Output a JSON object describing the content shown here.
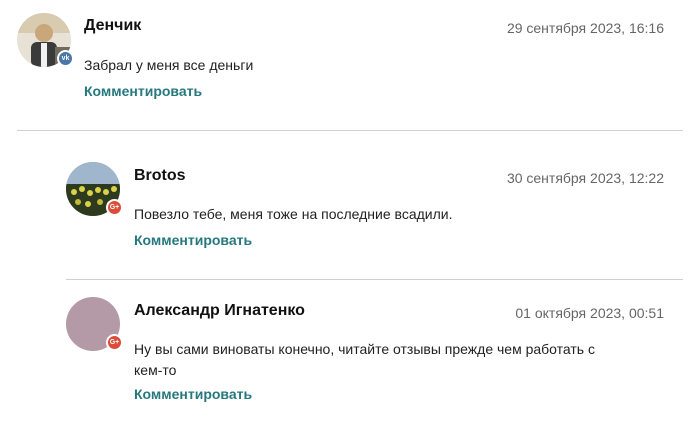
{
  "comments": [
    {
      "author": "Денчик",
      "date": "29 сентября 2023, 16:16",
      "text": "Забрал у меня все деньги",
      "reply_label": "Комментировать",
      "network_icon": "vk-icon",
      "network_badge": "vk",
      "avatar_colors": [
        "#c9a77a",
        "#3b3b3b",
        "#e8e2d6"
      ]
    },
    {
      "author": "Brotos",
      "date": "30 сентября 2023, 12:22",
      "text": "Повезло тебе, меня тоже на последние всадили.",
      "reply_label": "Комментировать",
      "network_icon": "google-plus-icon",
      "network_badge": "G+",
      "avatar_colors": [
        "#2d3a1e",
        "#d9d24a",
        "#8aa0b8"
      ]
    },
    {
      "author": "Александр Игнатенко",
      "date": "01 октября 2023, 00:51",
      "text": "Ну вы сами виноваты конечно, читайте отзывы прежде чем работать с кем-то",
      "reply_label": "Комментировать",
      "network_icon": "google-plus-icon",
      "network_badge": "G+",
      "avatar_colors": [
        "#b49aa6"
      ]
    }
  ]
}
